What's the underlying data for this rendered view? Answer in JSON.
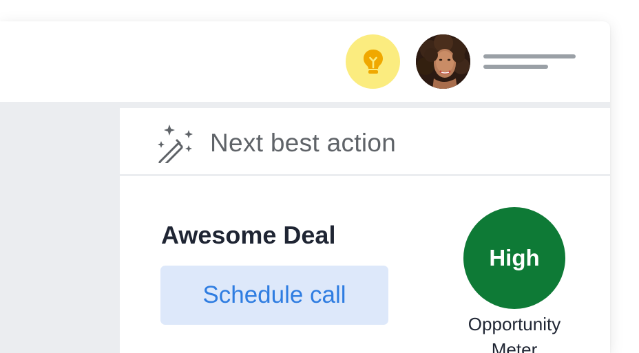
{
  "topbar": {
    "bulb_icon": "lightbulb-icon",
    "avatar_alt": "user avatar"
  },
  "panel": {
    "title": "Next best action",
    "title_icon": "magic-wand-sparkles-icon",
    "deal_name": "Awesome Deal",
    "action_button_label": "Schedule call",
    "meter": {
      "level": "High",
      "label_line_1": "Opportunity",
      "label_line_2": "Meter"
    }
  },
  "colors": {
    "bulb_background": "#fbec7f",
    "bulb_icon": "#f0a800",
    "meter_green": "#0e7a36",
    "button_background": "#dde8fa",
    "button_text": "#2f7de1",
    "app_background": "#ebedf0"
  }
}
